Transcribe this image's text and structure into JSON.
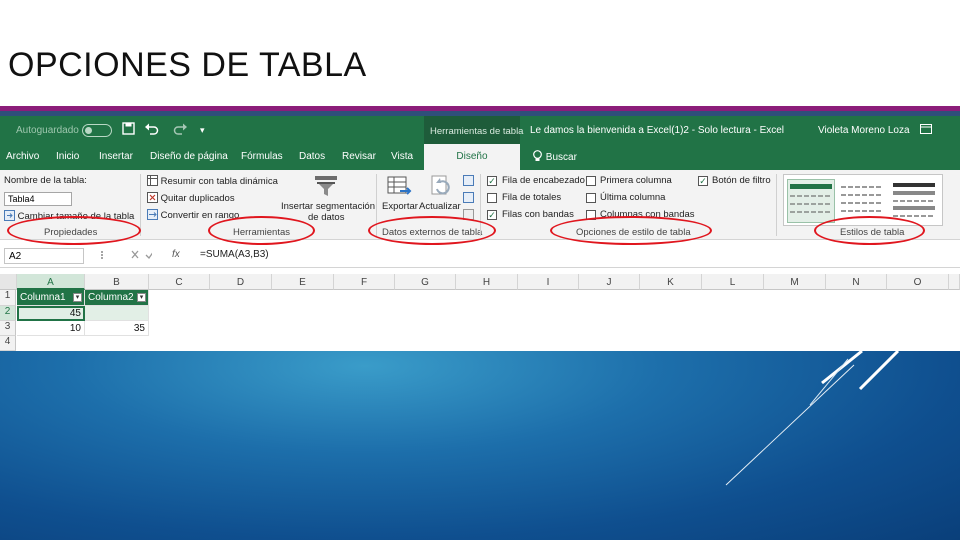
{
  "slide": {
    "title": "OPCIONES DE TABLA"
  },
  "titlebar": {
    "autosave": "Autoguardado",
    "context_tab": "Herramientas de tabla",
    "doc_title": "Le damos la bienvenida a Excel(1)2  -  Solo lectura  -  Excel",
    "user": "Violeta Moreno Loza"
  },
  "tabs": [
    "Archivo",
    "Inicio",
    "Insertar",
    "Diseño de página",
    "Fórmulas",
    "Datos",
    "Revisar",
    "Vista",
    "Diseño"
  ],
  "search_tab": "Buscar",
  "ribbon": {
    "properties": {
      "name_label": "Nombre de la tabla:",
      "name_value": "Tabla4",
      "resize": "Cambiar tamaño de la tabla",
      "group": "Propiedades"
    },
    "tools": {
      "pivot": "Resumir con tabla dinámica",
      "remove_dup": "Quitar duplicados",
      "convert": "Convertir en rango",
      "slicer_line1": "Insertar segmentación",
      "slicer_line2": "de datos",
      "group": "Herramientas"
    },
    "external": {
      "export": "Exportar",
      "refresh": "Actualizar",
      "group": "Datos externos de tabla"
    },
    "style_options": {
      "header_row": "Fila de encabezado",
      "total_row": "Fila de totales",
      "banded_rows": "Filas con bandas",
      "first_col": "Primera columna",
      "last_col": "Última columna",
      "banded_cols": "Columnas con bandas",
      "filter_btn": "Botón de filtro",
      "group": "Opciones de estilo de tabla"
    },
    "styles": {
      "group": "Estilos de tabla"
    }
  },
  "formula": {
    "namebox": "A2",
    "fx": "fx",
    "text": "=SUMA(A3,B3)"
  },
  "grid": {
    "columns": [
      "A",
      "B",
      "C",
      "D",
      "E",
      "F",
      "G",
      "H",
      "I",
      "J",
      "K",
      "L",
      "M",
      "N",
      "O"
    ],
    "rows": [
      "1",
      "2",
      "3",
      "4"
    ],
    "table": {
      "header": [
        "Columna1",
        "Columna2"
      ],
      "a2": "45",
      "a3": "10",
      "b3": "35"
    }
  },
  "colors": {
    "excel_green": "#217346",
    "accent_magenta": "#8c1d7a",
    "highlight_red": "#e0161e",
    "background_blue": "#1d6fab"
  }
}
